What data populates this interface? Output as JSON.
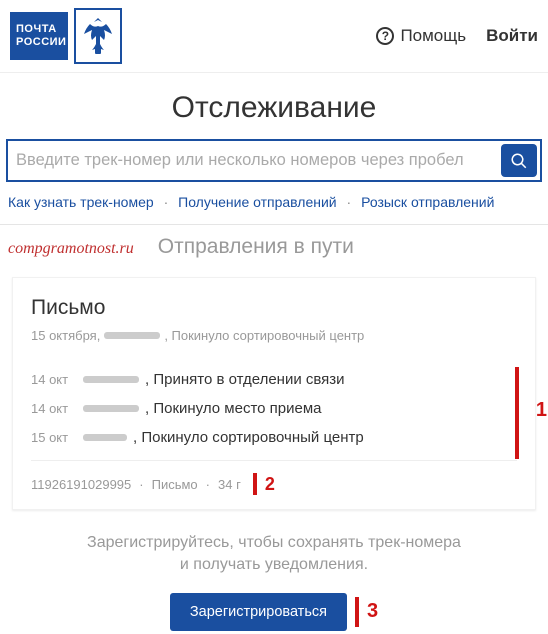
{
  "header": {
    "logo_line1": "ПОЧТА",
    "logo_line2": "РОССИИ",
    "help_label": "Помощь",
    "login_label": "Войти"
  },
  "page": {
    "title": "Отслеживание"
  },
  "search": {
    "placeholder": "Введите трек-номер или несколько номеров через пробел"
  },
  "sublinks": {
    "a": "Как узнать трек-номер",
    "b": "Получение отправлений",
    "c": "Розыск отправлений"
  },
  "band": {
    "watermark": "compgramotnost.ru",
    "title": "Отправления в пути"
  },
  "card": {
    "title": "Письмо",
    "sub_date": "15 октября,",
    "sub_status": ", Покинуло сортировочный центр",
    "events": [
      {
        "date": "14 окт",
        "text": ", Принято в отделении связи"
      },
      {
        "date": "14 окт",
        "text": ", Покинуло место приема"
      },
      {
        "date": "15 окт",
        "text": ", Покинуло сортировочный центр"
      }
    ],
    "footer": {
      "track": "11926191029995",
      "type": "Письмо",
      "weight": "34 г"
    }
  },
  "annotations": {
    "n1": "1",
    "n2": "2",
    "n3": "3"
  },
  "cta": {
    "text_l1": "Зарегистрируйтесь, чтобы сохранять трек-номера",
    "text_l2": "и получать уведомления.",
    "button": "Зарегистрироваться"
  },
  "dots": {
    "sep": "·"
  }
}
